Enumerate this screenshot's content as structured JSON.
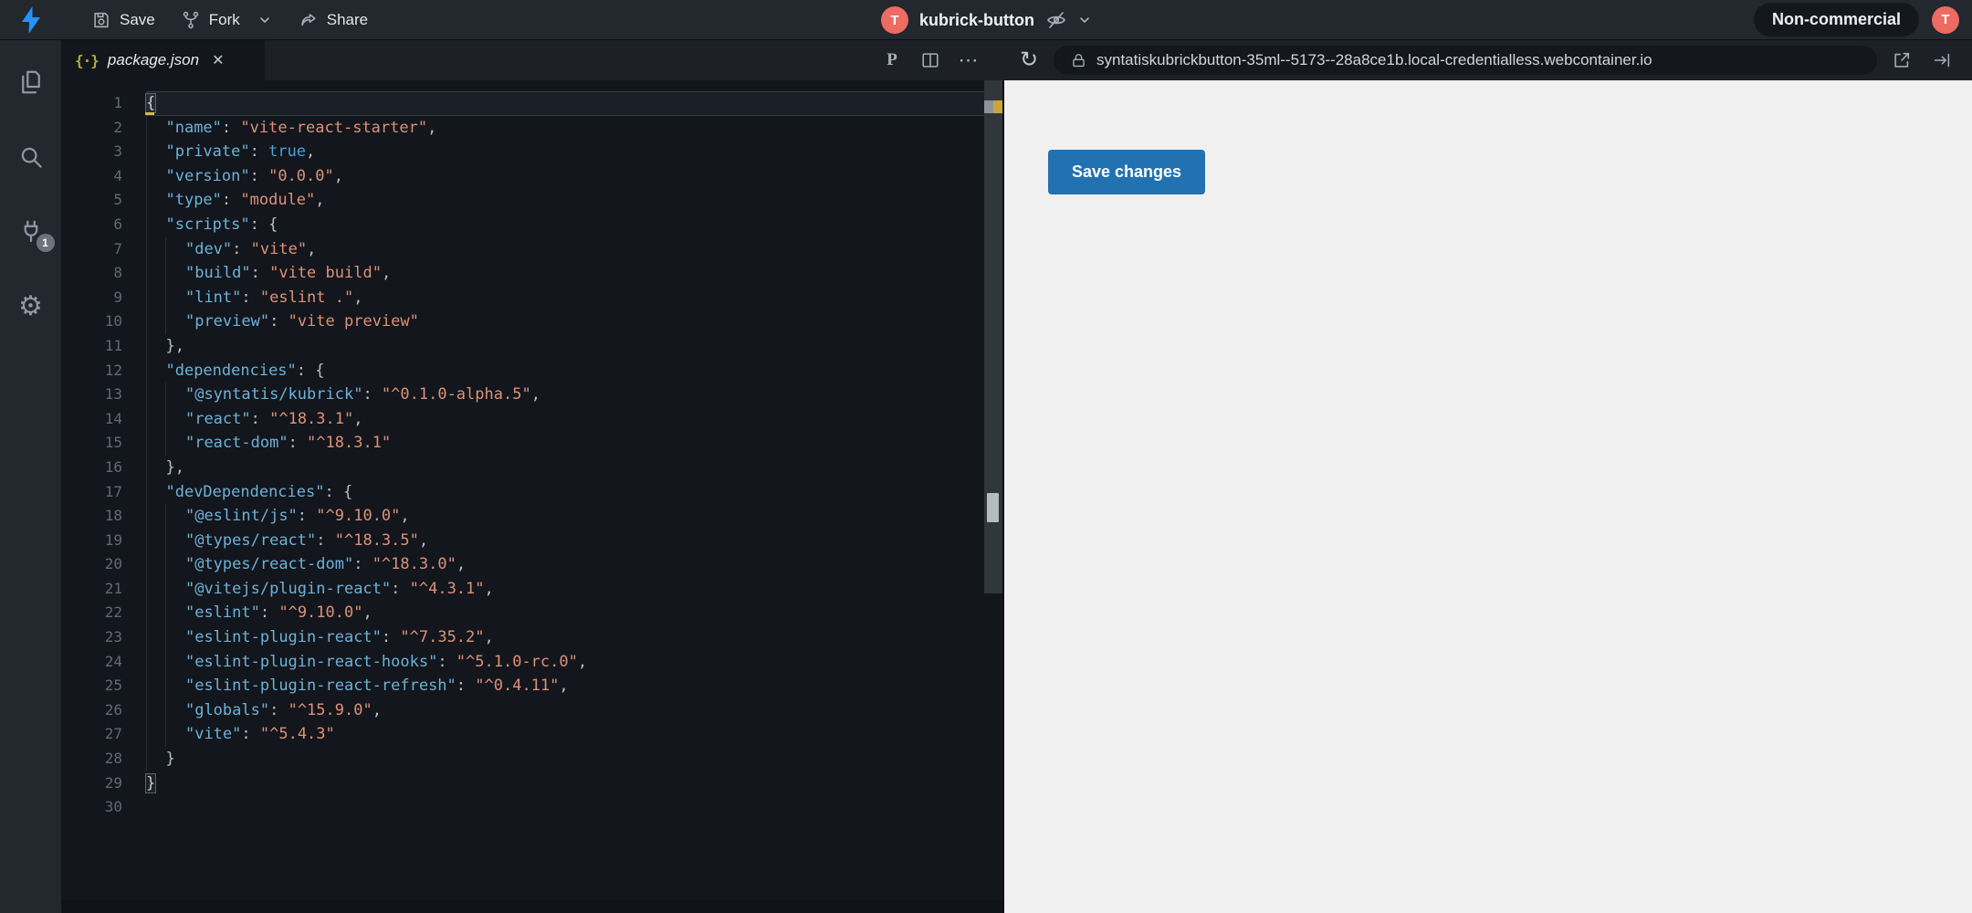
{
  "topbar": {
    "save_label": "Save",
    "fork_label": "Fork",
    "share_label": "Share",
    "project_avatar_letter": "T",
    "project_name": "kubrick-button",
    "license_badge": "Non-commercial",
    "user_avatar_letter": "T"
  },
  "sidebar": {
    "items": [
      {
        "name": "files",
        "icon": "files-icon"
      },
      {
        "name": "search",
        "icon": "search-icon"
      },
      {
        "name": "ports",
        "icon": "plug-icon",
        "badge": "1"
      },
      {
        "name": "settings",
        "icon": "gear-icon"
      }
    ],
    "gear_glyph": "⚙"
  },
  "editor": {
    "tab": {
      "label": "package.json",
      "icon_glyph": "{·}",
      "close_glyph": "✕"
    },
    "toolbar": {
      "prettier_glyph": "P",
      "more_glyph": "⋯"
    },
    "colors": {
      "key": "#6cb2d8",
      "string": "#de9178",
      "boolean": "#4ba0da",
      "punctuation": "#b8bec8",
      "line_number": "#5f6a78",
      "background": "#13161c"
    },
    "code": {
      "language": "json",
      "file": "package.json",
      "current_line": 1,
      "total_lines": 30,
      "lines": [
        [
          [
            "brace-cursor",
            "{"
          ]
        ],
        [
          [
            "ws",
            "  "
          ],
          [
            "key",
            "\"name\""
          ],
          [
            "punct",
            ": "
          ],
          [
            "str",
            "\"vite-react-starter\""
          ],
          [
            "punct",
            ","
          ]
        ],
        [
          [
            "ws",
            "  "
          ],
          [
            "key",
            "\"private\""
          ],
          [
            "punct",
            ": "
          ],
          [
            "bool",
            "true"
          ],
          [
            "punct",
            ","
          ]
        ],
        [
          [
            "ws",
            "  "
          ],
          [
            "key",
            "\"version\""
          ],
          [
            "punct",
            ": "
          ],
          [
            "str",
            "\"0.0.0\""
          ],
          [
            "punct",
            ","
          ]
        ],
        [
          [
            "ws",
            "  "
          ],
          [
            "key",
            "\"type\""
          ],
          [
            "punct",
            ": "
          ],
          [
            "str",
            "\"module\""
          ],
          [
            "punct",
            ","
          ]
        ],
        [
          [
            "ws",
            "  "
          ],
          [
            "key",
            "\"scripts\""
          ],
          [
            "punct",
            ": {"
          ]
        ],
        [
          [
            "ws",
            "    "
          ],
          [
            "key",
            "\"dev\""
          ],
          [
            "punct",
            ": "
          ],
          [
            "str",
            "\"vite\""
          ],
          [
            "punct",
            ","
          ]
        ],
        [
          [
            "ws",
            "    "
          ],
          [
            "key",
            "\"build\""
          ],
          [
            "punct",
            ": "
          ],
          [
            "str",
            "\"vite build\""
          ],
          [
            "punct",
            ","
          ]
        ],
        [
          [
            "ws",
            "    "
          ],
          [
            "key",
            "\"lint\""
          ],
          [
            "punct",
            ": "
          ],
          [
            "str",
            "\"eslint .\""
          ],
          [
            "punct",
            ","
          ]
        ],
        [
          [
            "ws",
            "    "
          ],
          [
            "key",
            "\"preview\""
          ],
          [
            "punct",
            ": "
          ],
          [
            "str",
            "\"vite preview\""
          ]
        ],
        [
          [
            "ws",
            "  "
          ],
          [
            "punct",
            "},"
          ]
        ],
        [
          [
            "ws",
            "  "
          ],
          [
            "key",
            "\"dependencies\""
          ],
          [
            "punct",
            ": {"
          ]
        ],
        [
          [
            "ws",
            "    "
          ],
          [
            "key",
            "\"@syntatis/kubrick\""
          ],
          [
            "punct",
            ": "
          ],
          [
            "str",
            "\"^0.1.0-alpha.5\""
          ],
          [
            "punct",
            ","
          ]
        ],
        [
          [
            "ws",
            "    "
          ],
          [
            "key",
            "\"react\""
          ],
          [
            "punct",
            ": "
          ],
          [
            "str",
            "\"^18.3.1\""
          ],
          [
            "punct",
            ","
          ]
        ],
        [
          [
            "ws",
            "    "
          ],
          [
            "key",
            "\"react-dom\""
          ],
          [
            "punct",
            ": "
          ],
          [
            "str",
            "\"^18.3.1\""
          ]
        ],
        [
          [
            "ws",
            "  "
          ],
          [
            "punct",
            "},"
          ]
        ],
        [
          [
            "ws",
            "  "
          ],
          [
            "key",
            "\"devDependencies\""
          ],
          [
            "punct",
            ": {"
          ]
        ],
        [
          [
            "ws",
            "    "
          ],
          [
            "key",
            "\"@eslint/js\""
          ],
          [
            "punct",
            ": "
          ],
          [
            "str",
            "\"^9.10.0\""
          ],
          [
            "punct",
            ","
          ]
        ],
        [
          [
            "ws",
            "    "
          ],
          [
            "key",
            "\"@types/react\""
          ],
          [
            "punct",
            ": "
          ],
          [
            "str",
            "\"^18.3.5\""
          ],
          [
            "punct",
            ","
          ]
        ],
        [
          [
            "ws",
            "    "
          ],
          [
            "key",
            "\"@types/react-dom\""
          ],
          [
            "punct",
            ": "
          ],
          [
            "str",
            "\"^18.3.0\""
          ],
          [
            "punct",
            ","
          ]
        ],
        [
          [
            "ws",
            "    "
          ],
          [
            "key",
            "\"@vitejs/plugin-react\""
          ],
          [
            "punct",
            ": "
          ],
          [
            "str",
            "\"^4.3.1\""
          ],
          [
            "punct",
            ","
          ]
        ],
        [
          [
            "ws",
            "    "
          ],
          [
            "key",
            "\"eslint\""
          ],
          [
            "punct",
            ": "
          ],
          [
            "str",
            "\"^9.10.0\""
          ],
          [
            "punct",
            ","
          ]
        ],
        [
          [
            "ws",
            "    "
          ],
          [
            "key",
            "\"eslint-plugin-react\""
          ],
          [
            "punct",
            ": "
          ],
          [
            "str",
            "\"^7.35.2\""
          ],
          [
            "punct",
            ","
          ]
        ],
        [
          [
            "ws",
            "    "
          ],
          [
            "key",
            "\"eslint-plugin-react-hooks\""
          ],
          [
            "punct",
            ": "
          ],
          [
            "str",
            "\"^5.1.0-rc.0\""
          ],
          [
            "punct",
            ","
          ]
        ],
        [
          [
            "ws",
            "    "
          ],
          [
            "key",
            "\"eslint-plugin-react-refresh\""
          ],
          [
            "punct",
            ": "
          ],
          [
            "str",
            "\"^0.4.11\""
          ],
          [
            "punct",
            ","
          ]
        ],
        [
          [
            "ws",
            "    "
          ],
          [
            "key",
            "\"globals\""
          ],
          [
            "punct",
            ": "
          ],
          [
            "str",
            "\"^15.9.0\""
          ],
          [
            "punct",
            ","
          ]
        ],
        [
          [
            "ws",
            "    "
          ],
          [
            "key",
            "\"vite\""
          ],
          [
            "punct",
            ": "
          ],
          [
            "str",
            "\"^5.4.3\""
          ]
        ],
        [
          [
            "ws",
            "  "
          ],
          [
            "punct",
            "}"
          ]
        ],
        [
          [
            "brace",
            "}"
          ]
        ],
        []
      ]
    }
  },
  "preview": {
    "toolbar": {
      "url": "syntatiskubrickbutton-35ml--5173--28a8ce1b.local-credentialless.webcontainer.io",
      "refresh_glyph": "↻"
    },
    "body": {
      "save_button_label": "Save changes",
      "button_color": "#2271b1",
      "background": "#f0f0f1"
    }
  }
}
